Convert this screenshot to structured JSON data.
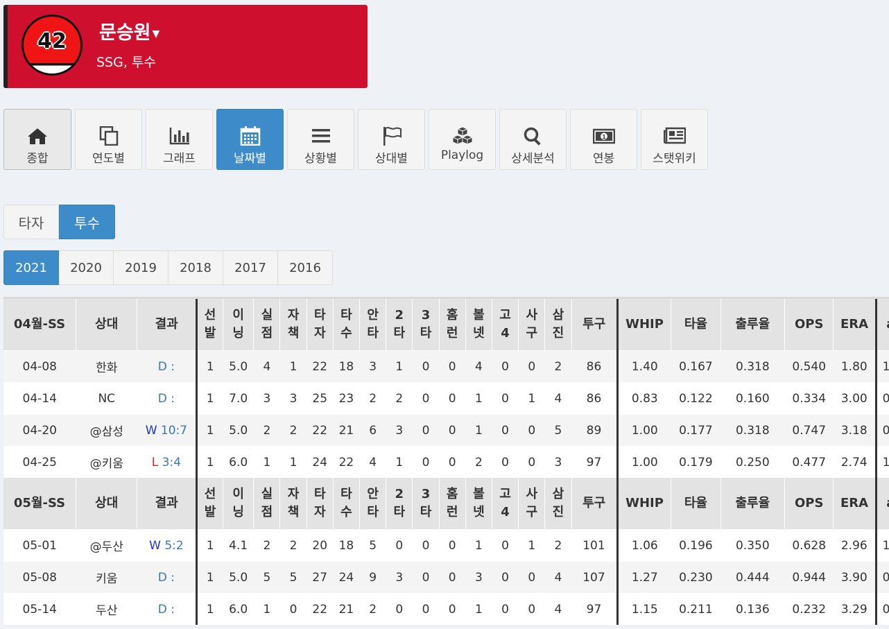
{
  "player": {
    "number": "42",
    "name": "문승원",
    "team_position": "SSG, 투수"
  },
  "nav": [
    {
      "label": "종합",
      "icon": "home-icon"
    },
    {
      "label": "연도별",
      "icon": "copy-icon"
    },
    {
      "label": "그래프",
      "icon": "bar-chart-icon"
    },
    {
      "label": "날짜별",
      "icon": "calendar-icon",
      "active": true
    },
    {
      "label": "상황별",
      "icon": "list-icon"
    },
    {
      "label": "상대별",
      "icon": "flag-icon"
    },
    {
      "label": "Playlog",
      "icon": "cubes-icon"
    },
    {
      "label": "상세분석",
      "icon": "search-icon"
    },
    {
      "label": "연봉",
      "icon": "money-icon"
    },
    {
      "label": "스탯위키",
      "icon": "newspaper-icon"
    }
  ],
  "role_tabs": {
    "batter": "타자",
    "pitcher": "투수"
  },
  "years": [
    "2021",
    "2020",
    "2019",
    "2018",
    "2017",
    "2016"
  ],
  "headers": {
    "opp": "상대",
    "result": "결과",
    "gs": [
      "선",
      "발"
    ],
    "ip": [
      "이",
      "닝"
    ],
    "r": [
      "실",
      "점"
    ],
    "er": [
      "자",
      "책"
    ],
    "pa": [
      "타",
      "자"
    ],
    "ab": [
      "타",
      "수"
    ],
    "h": [
      "안",
      "타"
    ],
    "d2": [
      "2",
      "타"
    ],
    "d3": [
      "3",
      "타"
    ],
    "hr": [
      "홈",
      "런"
    ],
    "bb": [
      "볼",
      "넷"
    ],
    "ibb": [
      "고",
      "4"
    ],
    "hbp": [
      "사",
      "구"
    ],
    "so": [
      "삼",
      "진"
    ],
    "np": "투구",
    "whip": "WHIP",
    "avg": "타율",
    "obp": "출루율",
    "ops": "OPS",
    "era": "ERA",
    "extra": "a"
  },
  "groups": [
    {
      "month": "04월-SS",
      "rows": [
        {
          "date": "04-08",
          "opp": "한화",
          "res": "D",
          "score": ":",
          "gs": "1",
          "ip": "5.0",
          "r": "4",
          "er": "1",
          "pa": "22",
          "ab": "18",
          "h": "3",
          "d2": "1",
          "d3": "0",
          "hr": "0",
          "bb": "4",
          "ibb": "0",
          "hbp": "0",
          "so": "2",
          "np": "86",
          "whip": "1.40",
          "avg": "0.167",
          "obp": "0.318",
          "ops": "0.540",
          "era": "1.80",
          "extra": "1"
        },
        {
          "date": "04-14",
          "opp": "NC",
          "res": "D",
          "score": ":",
          "gs": "1",
          "ip": "7.0",
          "r": "3",
          "er": "3",
          "pa": "25",
          "ab": "23",
          "h": "2",
          "d2": "2",
          "d3": "0",
          "hr": "0",
          "bb": "1",
          "ibb": "0",
          "hbp": "1",
          "so": "4",
          "np": "86",
          "whip": "0.83",
          "avg": "0.122",
          "obp": "0.160",
          "ops": "0.334",
          "era": "3.00",
          "extra": "0"
        },
        {
          "date": "04-20",
          "opp": "@삼성",
          "res": "W",
          "score": "10:7",
          "gs": "1",
          "ip": "5.0",
          "r": "2",
          "er": "2",
          "pa": "22",
          "ab": "21",
          "h": "6",
          "d2": "3",
          "d3": "0",
          "hr": "0",
          "bb": "1",
          "ibb": "0",
          "hbp": "0",
          "so": "5",
          "np": "89",
          "whip": "1.00",
          "avg": "0.177",
          "obp": "0.318",
          "ops": "0.747",
          "era": "3.18",
          "extra": "0"
        },
        {
          "date": "04-25",
          "opp": "@키움",
          "res": "L",
          "score": "3:4",
          "gs": "1",
          "ip": "6.0",
          "r": "1",
          "er": "1",
          "pa": "24",
          "ab": "22",
          "h": "4",
          "d2": "1",
          "d3": "0",
          "hr": "0",
          "bb": "2",
          "ibb": "0",
          "hbp": "0",
          "so": "3",
          "np": "97",
          "whip": "1.00",
          "avg": "0.179",
          "obp": "0.250",
          "ops": "0.477",
          "era": "2.74",
          "extra": "1"
        }
      ]
    },
    {
      "month": "05월-SS",
      "rows": [
        {
          "date": "05-01",
          "opp": "@두산",
          "res": "W",
          "score": "5:2",
          "gs": "1",
          "ip": "4.1",
          "r": "2",
          "er": "2",
          "pa": "20",
          "ab": "18",
          "h": "5",
          "d2": "0",
          "d3": "0",
          "hr": "0",
          "bb": "1",
          "ibb": "0",
          "hbp": "1",
          "so": "2",
          "np": "101",
          "whip": "1.06",
          "avg": "0.196",
          "obp": "0.350",
          "ops": "0.628",
          "era": "2.96",
          "extra": "1"
        },
        {
          "date": "05-08",
          "opp": "키움",
          "res": "D",
          "score": ":",
          "gs": "1",
          "ip": "5.0",
          "r": "5",
          "er": "5",
          "pa": "27",
          "ab": "24",
          "h": "9",
          "d2": "3",
          "d3": "0",
          "hr": "0",
          "bb": "3",
          "ibb": "0",
          "hbp": "0",
          "so": "4",
          "np": "107",
          "whip": "1.27",
          "avg": "0.230",
          "obp": "0.444",
          "ops": "0.944",
          "era": "3.90",
          "extra": "0"
        },
        {
          "date": "05-14",
          "opp": "두산",
          "res": "D",
          "score": ":",
          "gs": "1",
          "ip": "6.0",
          "r": "1",
          "er": "0",
          "pa": "22",
          "ab": "21",
          "h": "2",
          "d2": "0",
          "d3": "0",
          "hr": "0",
          "bb": "1",
          "ibb": "0",
          "hbp": "0",
          "so": "4",
          "np": "97",
          "whip": "1.15",
          "avg": "0.211",
          "obp": "0.136",
          "ops": "0.232",
          "era": "3.29",
          "extra": "0"
        }
      ]
    }
  ]
}
